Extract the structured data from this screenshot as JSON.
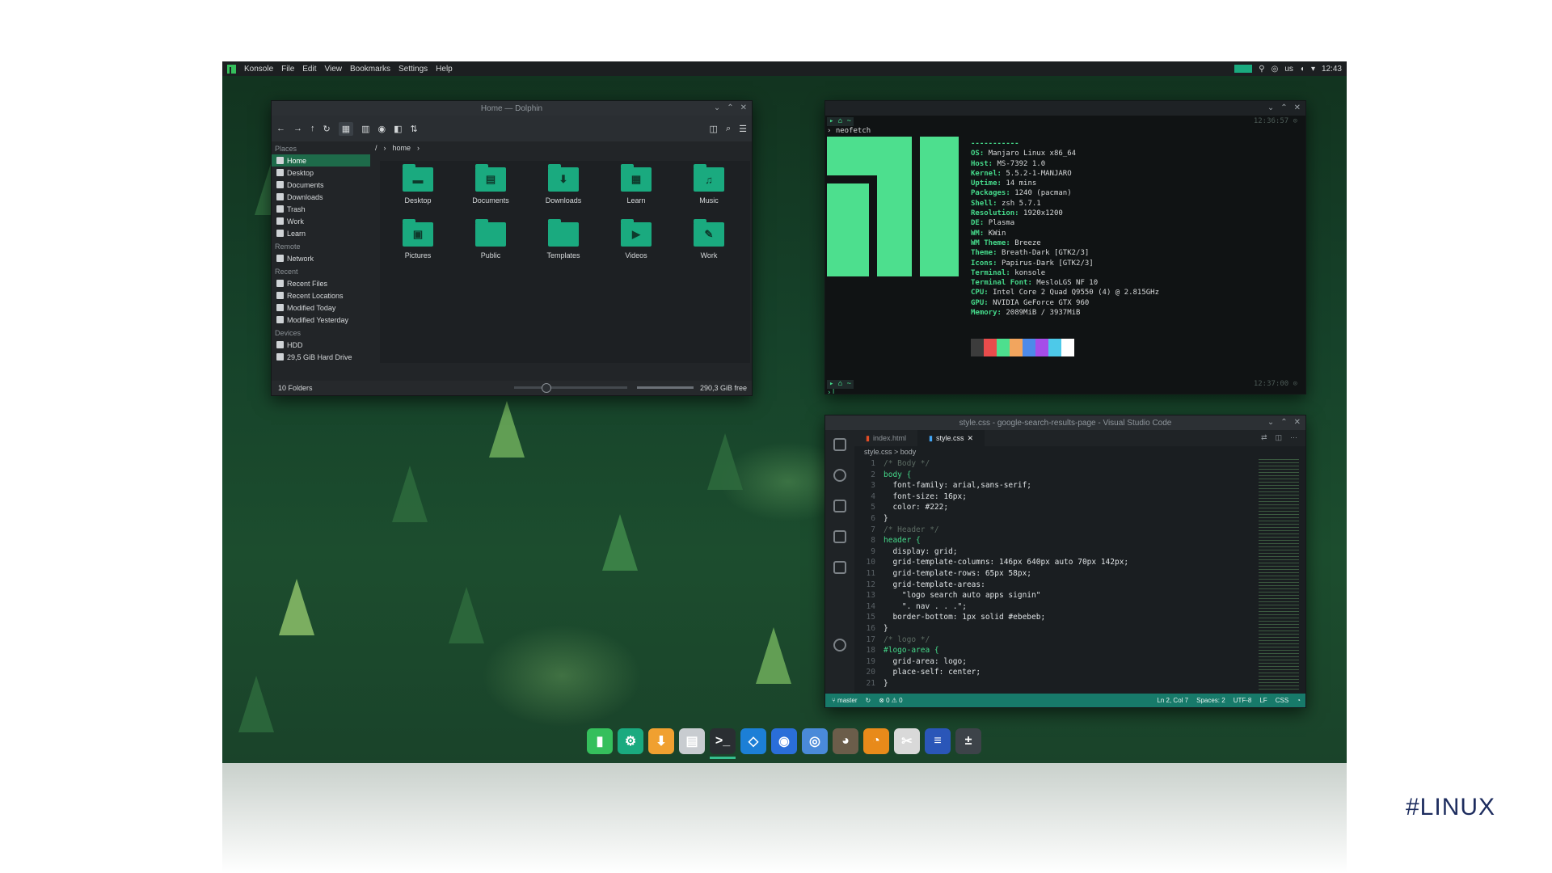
{
  "topbar": {
    "app": "Konsole",
    "menus": [
      "File",
      "Edit",
      "View",
      "Bookmarks",
      "Settings",
      "Help"
    ],
    "keyboard": "us",
    "clock": "12:43"
  },
  "dolphin": {
    "title": "Home — Dolphin",
    "sidebar": {
      "places_header": "Places",
      "places": [
        "Home",
        "Desktop",
        "Documents",
        "Downloads",
        "Trash",
        "Work",
        "Learn"
      ],
      "remote_header": "Remote",
      "remote": [
        "Network"
      ],
      "recent_header": "Recent",
      "recent": [
        "Recent Files",
        "Recent Locations",
        "Modified Today",
        "Modified Yesterday"
      ],
      "devices_header": "Devices",
      "devices": [
        "HDD",
        "29,5 GiB Hard Drive"
      ]
    },
    "breadcrumb": {
      "root": "/",
      "home": "home"
    },
    "folders": [
      {
        "name": "Desktop",
        "glyph": "▬"
      },
      {
        "name": "Documents",
        "glyph": "▤"
      },
      {
        "name": "Downloads",
        "glyph": "⬇"
      },
      {
        "name": "Learn",
        "glyph": "▦"
      },
      {
        "name": "Music",
        "glyph": "♫"
      },
      {
        "name": "Pictures",
        "glyph": "▣"
      },
      {
        "name": "Public",
        "glyph": ""
      },
      {
        "name": "Templates",
        "glyph": ""
      },
      {
        "name": "Videos",
        "glyph": "▶"
      },
      {
        "name": "Work",
        "glyph": "✎"
      }
    ],
    "status": {
      "count": "10 Folders",
      "free": "290,3 GiB free"
    }
  },
  "konsole": {
    "command": "neofetch",
    "time1": "12:36:57 ⊙",
    "time2": "12:37:00 ⊙",
    "separator": "-----------",
    "info": [
      {
        "k": "OS",
        "v": "Manjaro Linux x86_64"
      },
      {
        "k": "Host",
        "v": "MS-7392 1.0"
      },
      {
        "k": "Kernel",
        "v": "5.5.2-1-MANJARO"
      },
      {
        "k": "Uptime",
        "v": "14 mins"
      },
      {
        "k": "Packages",
        "v": "1240 (pacman)"
      },
      {
        "k": "Shell",
        "v": "zsh 5.7.1"
      },
      {
        "k": "Resolution",
        "v": "1920x1200"
      },
      {
        "k": "DE",
        "v": "Plasma"
      },
      {
        "k": "WM",
        "v": "KWin"
      },
      {
        "k": "WM Theme",
        "v": "Breeze"
      },
      {
        "k": "Theme",
        "v": "Breath-Dark [GTK2/3]"
      },
      {
        "k": "Icons",
        "v": "Papirus-Dark [GTK2/3]"
      },
      {
        "k": "Terminal",
        "v": "konsole"
      },
      {
        "k": "Terminal Font",
        "v": "MesloLGS NF 10"
      },
      {
        "k": "CPU",
        "v": "Intel Core 2 Quad Q9550 (4) @ 2.815GHz"
      },
      {
        "k": "GPU",
        "v": "NVIDIA GeForce GTX 960"
      },
      {
        "k": "Memory",
        "v": "2089MiB / 3937MiB"
      }
    ],
    "swatch_colors": [
      "#3c3c3c",
      "#e94c4c",
      "#4ddf8e",
      "#f2a55e",
      "#4d8ae9",
      "#a64de9",
      "#4dc9e9",
      "#ffffff"
    ]
  },
  "vscode": {
    "title": "style.css - google-search-results-page - Visual Studio Code",
    "tabs": [
      "index.html",
      "style.css"
    ],
    "breadcrumb": "style.css > body",
    "lines": [
      "/* Body */",
      "body {",
      "  font-family: arial,sans-serif;",
      "  font-size: 16px;",
      "  color: #222;",
      "}",
      "/* Header */",
      "header {",
      "  display: grid;",
      "  grid-template-columns: 146px 640px auto 70px 142px;",
      "  grid-template-rows: 65px 58px;",
      "  grid-template-areas:",
      "    \"logo search auto apps signin\"",
      "    \". nav . . .\";",
      "  border-bottom: 1px solid #ebebeb;",
      "}",
      "/* logo */",
      "#logo-area {",
      "  grid-area: logo;",
      "  place-self: center;",
      "}"
    ],
    "status": {
      "branch": "master",
      "errors": "⊗ 0 ⚠ 0",
      "position": "Ln 2, Col 7",
      "spaces": "Spaces: 2",
      "encoding": "UTF-8",
      "eol": "LF",
      "lang": "CSS"
    }
  },
  "dock": [
    {
      "name": "manjaro-icon",
      "glyph": "▮",
      "color": "#35bf5c"
    },
    {
      "name": "settings-icon",
      "glyph": "⚙",
      "color": "#1aaa7f"
    },
    {
      "name": "downloads-icon",
      "glyph": "⬇",
      "color": "#f0a030"
    },
    {
      "name": "files-icon",
      "glyph": "▤",
      "color": "#c8ccd0"
    },
    {
      "name": "terminal-icon",
      "glyph": ">_",
      "color": "#2a2e32"
    },
    {
      "name": "vscode-icon",
      "glyph": "◇",
      "color": "#1c7fd6"
    },
    {
      "name": "firefox-icon",
      "glyph": "◉",
      "color": "#2a6ed9"
    },
    {
      "name": "chromium-icon",
      "glyph": "◎",
      "color": "#4a8ad9"
    },
    {
      "name": "gimp-icon",
      "glyph": "◕",
      "color": "#6b5d4a"
    },
    {
      "name": "blender-icon",
      "glyph": "◔",
      "color": "#e88a1a"
    },
    {
      "name": "shutter-icon",
      "glyph": "✂",
      "color": "#d9d9d9"
    },
    {
      "name": "writer-icon",
      "glyph": "≡",
      "color": "#2a56b8"
    },
    {
      "name": "calculator-icon",
      "glyph": "±",
      "color": "#3d4349"
    }
  ],
  "hashtag": "#LINUX"
}
